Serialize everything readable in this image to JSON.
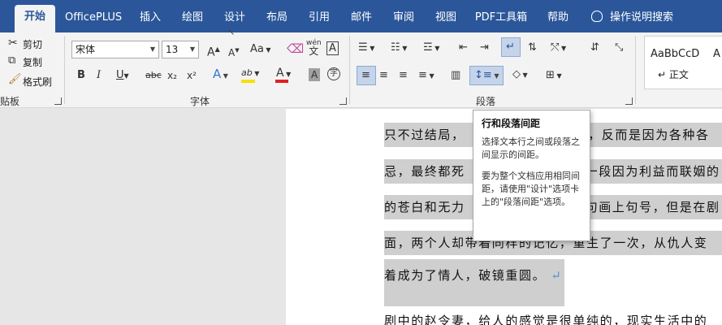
{
  "tabs": [
    "开始",
    "OfficePLUS",
    "插入",
    "绘图",
    "设计",
    "布局",
    "引用",
    "邮件",
    "审阅",
    "视图",
    "PDF工具箱",
    "帮助"
  ],
  "tell_me": "操作说明搜索",
  "clipboard": {
    "cut": "剪切",
    "copy": "复制",
    "format_painter": "格式刷",
    "group_label": "贴板"
  },
  "font": {
    "name": "宋体",
    "size": "13",
    "grow": "A",
    "shrink": "A",
    "case": "Aa",
    "phonetic_top": "wén",
    "phonetic_bottom": "文",
    "border_char": "A",
    "bold": "B",
    "italic": "I",
    "underline": "U",
    "strike": "abc",
    "subscript": "x₂",
    "superscript": "x²",
    "effects": "A",
    "highlight": "ab",
    "font_color": "A",
    "shading": "A",
    "enclose": "字",
    "group_label": "字体"
  },
  "paragraph": {
    "group_label": "段落"
  },
  "styles": {
    "sample": "AaBbCcD",
    "sample_cut": "A",
    "normal_label": "正文"
  },
  "tooltip": {
    "title": "行和段落间距",
    "p1": "选择文本行之间或段落之间显示的间距。",
    "p2": "要为整个文档应用相同间距，请使用\"设计\"选项卡上的\"段落间距\"选项。"
  },
  "document": {
    "line1_a": "只不过结局，",
    "line1_b": "满，反而是因为各种各",
    "line2_a": "忌，最终都死",
    "line2_b": "一段因为利益而联姻的",
    "line3_a": "的苍白和无力",
    "line3_b": "句画上句号，但是在剧",
    "line4": "面，两个人却带着同样的记忆，重生了一次，从仇人变",
    "line5": "着成为了情人，破镜重圆。",
    "line6": "剧中的赵令妻，给人的感觉是很单纯的，现实生活中的"
  },
  "colors": {
    "tab_bar": "#2b579a",
    "selection": "#cfcfcf",
    "highlight_bar": "#f5e100",
    "font_color_bar": "#e02020"
  }
}
